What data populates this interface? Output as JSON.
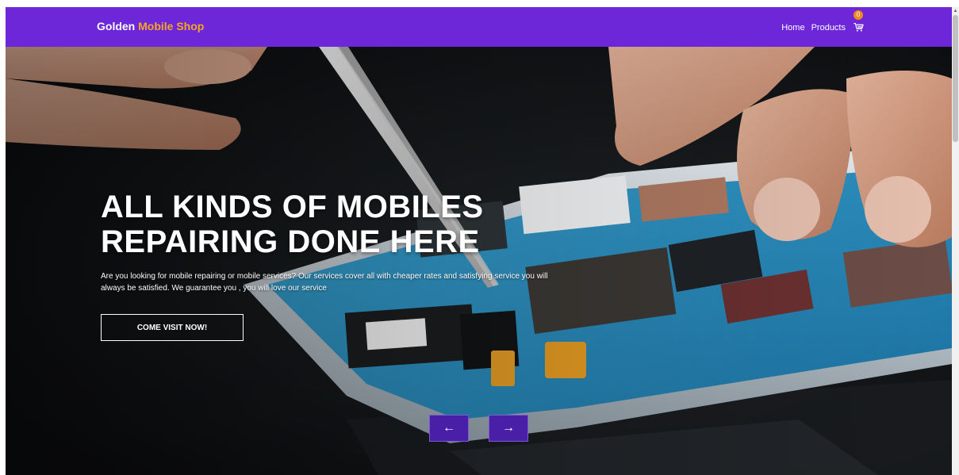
{
  "navbar": {
    "brand_part1": "Golden ",
    "brand_part2": "Mobile Shop",
    "links": [
      "Home",
      "Products"
    ],
    "cart_count": "0",
    "cart_icon": "cart-icon",
    "bg_color": "#6d27d9",
    "accent_color": "#f5a623"
  },
  "hero": {
    "title": "ALL KINDS OF MOBILES REPAIRING DONE HERE",
    "description": "Are you looking for mobile repairing or mobile services? Our services cover all with cheaper rates and satisfying service you will always be satisfied. We guarantee you , you will love our service",
    "cta_label": "COME VISIT NOW!",
    "prev_label": "←",
    "next_label": "→",
    "arrow_color": "#4a1fa8"
  }
}
